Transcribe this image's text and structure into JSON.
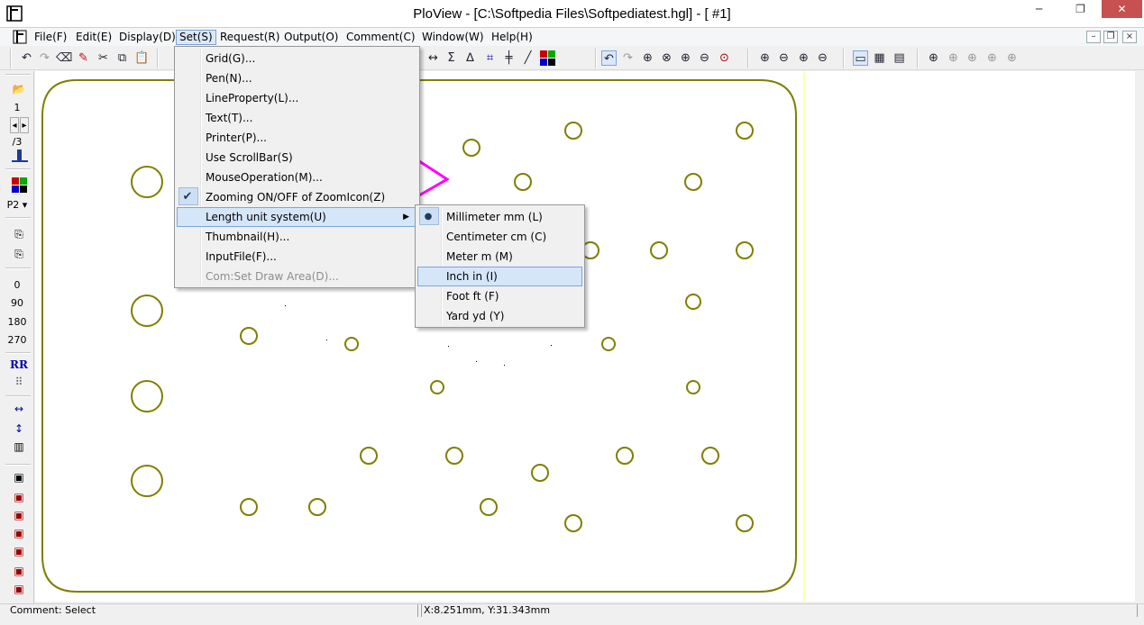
{
  "window": {
    "title": "PloView - [C:\\Softpedia Files\\Softpediatest.hgl] - [ #1]",
    "controls": [
      "─",
      "❐",
      "✕"
    ]
  },
  "menubar": {
    "items": [
      "File(F)",
      "Edit(E)",
      "Display(D)",
      "Set(S)",
      "Request(R)",
      "Output(O)",
      "Comment(C)",
      "Window(W)",
      "Help(H)"
    ],
    "mdi_controls": [
      "–",
      "❐",
      "×"
    ]
  },
  "set_menu": {
    "items": [
      {
        "label": "Grid(G)..."
      },
      {
        "label": "Pen(N)..."
      },
      {
        "label": "LineProperty(L)..."
      },
      {
        "label": "Text(T)..."
      },
      {
        "label": "Printer(P)..."
      },
      {
        "label": "Use ScrollBar(S)"
      },
      {
        "label": "MouseOperation(M)..."
      },
      {
        "label": "Zooming ON/OFF of ZoomIcon(Z)"
      },
      {
        "label": "Length unit system(U)"
      },
      {
        "label": "Thumbnail(H)..."
      },
      {
        "label": "InputFile(F)..."
      },
      {
        "label": "Com:Set Draw Area(D)..."
      }
    ]
  },
  "unit_submenu": {
    "items": [
      {
        "label": "Millimeter mm (L)"
      },
      {
        "label": "Centimeter cm (C)"
      },
      {
        "label": "Meter m (M)"
      },
      {
        "label": "Inch in (I)"
      },
      {
        "label": "Foot ft (F)"
      },
      {
        "label": "Yard yd (Y)"
      }
    ]
  },
  "left_toolbar": {
    "page_current": "1",
    "page_total": "/3",
    "pen_label": "P2",
    "rotations": [
      "0",
      "90",
      "180",
      "270"
    ]
  },
  "statusbar": {
    "comment": "Comment: Select",
    "coords": "X:8.251mm, Y:31.343mm"
  },
  "colors": {
    "drawing": "#7f7f00",
    "highlight": "#ff00ff",
    "menu_hover": "#d5e6f8"
  }
}
